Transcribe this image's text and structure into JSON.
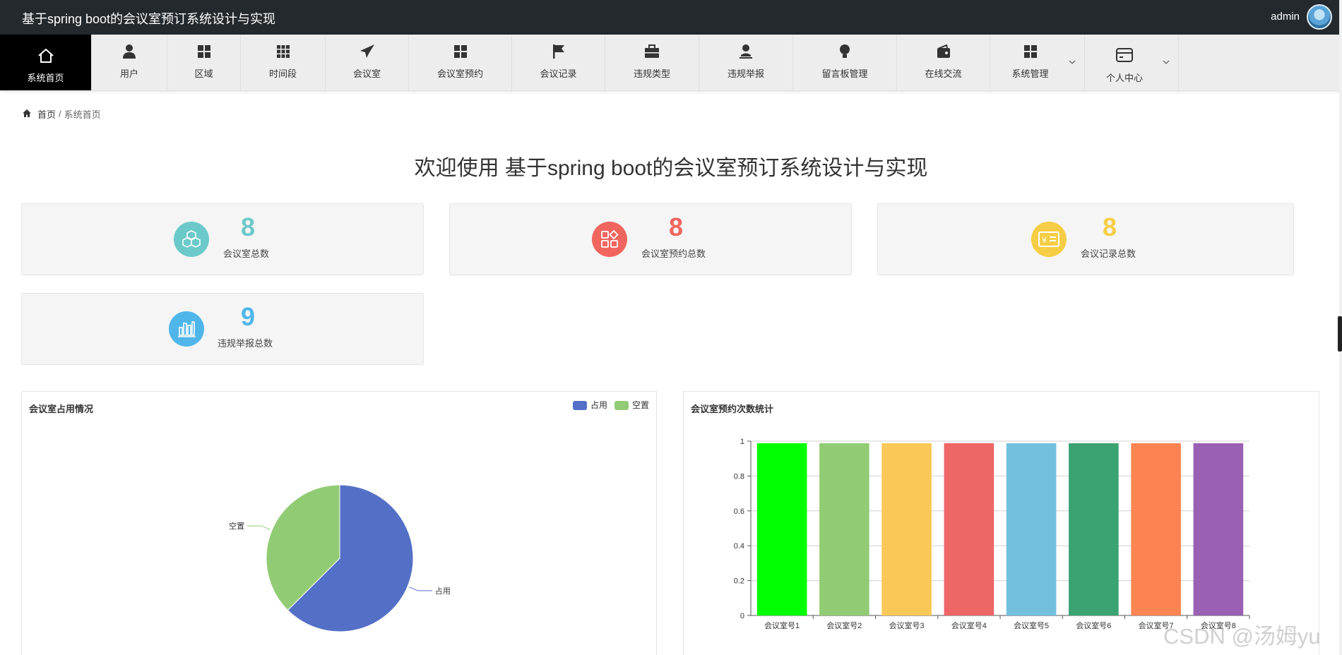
{
  "app": {
    "title": "基于spring boot的会议室预订系统设计与实现",
    "username": "admin"
  },
  "nav": [
    {
      "label": "系统首页",
      "icon": "home-icon",
      "active": true
    },
    {
      "label": "用户",
      "icon": "user-icon"
    },
    {
      "label": "区域",
      "icon": "grid-icon"
    },
    {
      "label": "时间段",
      "icon": "apps-icon"
    },
    {
      "label": "会议室",
      "icon": "paper-plane-icon"
    },
    {
      "label": "会议室预约",
      "icon": "grid-icon"
    },
    {
      "label": "会议记录",
      "icon": "flag-icon"
    },
    {
      "label": "违规类型",
      "icon": "briefcase-icon"
    },
    {
      "label": "违规举报",
      "icon": "person-icon"
    },
    {
      "label": "留言板管理",
      "icon": "bulb-icon"
    },
    {
      "label": "在线交流",
      "icon": "wallet-icon"
    },
    {
      "label": "系统管理",
      "icon": "grid-icon",
      "dropdown": true
    },
    {
      "label": "个人中心",
      "icon": "card-icon",
      "dropdown": true
    }
  ],
  "breadcrumb": {
    "home": "首页",
    "separator": "/",
    "current": "系统首页"
  },
  "welcome": "欢迎使用 基于spring boot的会议室预订系统设计与实现",
  "stats": [
    {
      "value": "8",
      "label": "会议室总数",
      "color": "#6cc9c9",
      "icon": "cubes-icon"
    },
    {
      "value": "8",
      "label": "会议室预约总数",
      "color": "#f0665f",
      "icon": "apps-shapes-icon"
    },
    {
      "value": "8",
      "label": "会议记录总数",
      "color": "#f6cd45",
      "icon": "ticket-icon"
    },
    {
      "value": "9",
      "label": "违规举报总数",
      "color": "#4fb6ea",
      "icon": "bar-chart-icon"
    }
  ],
  "pie_panel": {
    "title": "会议室占用情况"
  },
  "bar_panel": {
    "title": "会议室预约次数统计"
  },
  "chart_data": [
    {
      "type": "pie",
      "title": "会议室占用情况",
      "series": [
        {
          "name": "占用",
          "value": 62.5,
          "color": "#5470c6"
        },
        {
          "name": "空置",
          "value": 37.5,
          "color": "#91cc75"
        }
      ],
      "legend": "top-right"
    },
    {
      "type": "bar",
      "title": "会议室预约次数统计",
      "categories": [
        "会议室号1",
        "会议室号2",
        "会议室号3",
        "会议室号4",
        "会议室号5",
        "会议室号6",
        "会议室号7",
        "会议室号8"
      ],
      "values": [
        1,
        1,
        1,
        1,
        1,
        1,
        1,
        1
      ],
      "colors": [
        "#00ff00",
        "#91cc75",
        "#fac858",
        "#ee6666",
        "#73c0de",
        "#3ba272",
        "#fc8452",
        "#9a60b4"
      ],
      "ylim": [
        0,
        1
      ],
      "yticks": [
        "0",
        "0.2",
        "0.4",
        "0.6",
        "0.8",
        "1"
      ],
      "grid": true
    }
  ],
  "watermark": "CSDN @汤姆yu"
}
